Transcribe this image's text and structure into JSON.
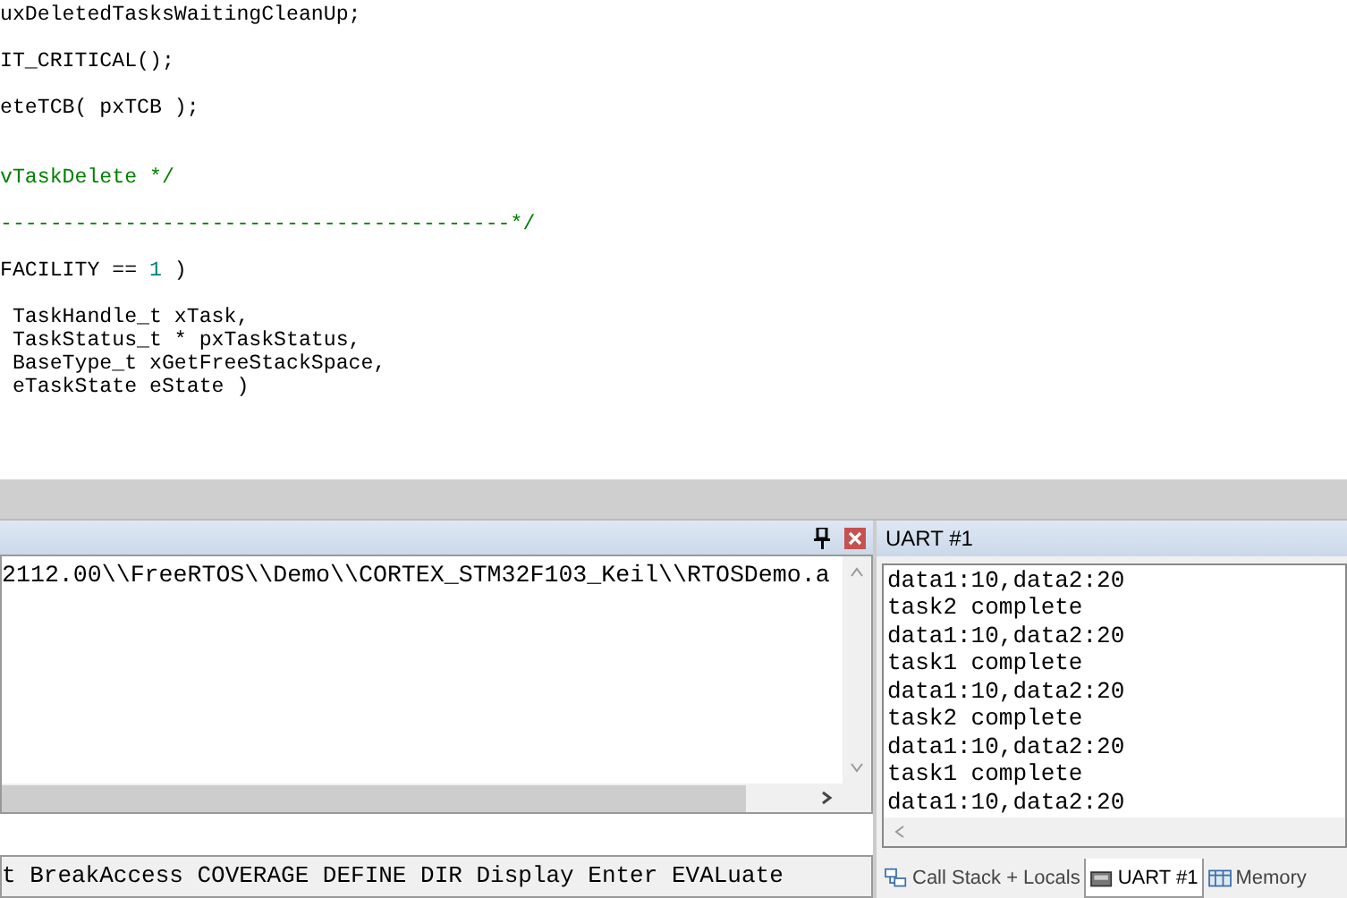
{
  "editor": {
    "lines": [
      {
        "kind": "code",
        "segments": [
          {
            "text": "uxDeletedTasksWaitingCleanUp;",
            "kind": "plain"
          }
        ]
      },
      {
        "kind": "blank"
      },
      {
        "kind": "code",
        "segments": [
          {
            "text": "IT_CRITICAL();",
            "kind": "plain"
          }
        ]
      },
      {
        "kind": "blank"
      },
      {
        "kind": "code",
        "segments": [
          {
            "text": "eteTCB( pxTCB );",
            "kind": "plain"
          }
        ]
      },
      {
        "kind": "blank"
      },
      {
        "kind": "blank"
      },
      {
        "kind": "code",
        "segments": [
          {
            "text": "vTaskDelete */",
            "kind": "comment"
          }
        ]
      },
      {
        "kind": "blank"
      },
      {
        "kind": "code",
        "segments": [
          {
            "text": "-----------------------------------------*/",
            "kind": "comment"
          }
        ]
      },
      {
        "kind": "blank"
      },
      {
        "kind": "code",
        "segments": [
          {
            "text": "FACILITY == ",
            "kind": "plain"
          },
          {
            "text": "1",
            "kind": "number"
          },
          {
            "text": " )",
            "kind": "plain"
          }
        ]
      },
      {
        "kind": "blank"
      },
      {
        "kind": "code",
        "segments": [
          {
            "text": " TaskHandle_t xTask,",
            "kind": "plain"
          }
        ]
      },
      {
        "kind": "code",
        "segments": [
          {
            "text": " TaskStatus_t * pxTaskStatus,",
            "kind": "plain"
          }
        ]
      },
      {
        "kind": "code",
        "segments": [
          {
            "text": " BaseType_t xGetFreeStackSpace,",
            "kind": "plain"
          }
        ]
      },
      {
        "kind": "code",
        "segments": [
          {
            "text": " eTaskState eState )",
            "kind": "plain"
          }
        ]
      }
    ]
  },
  "command_panel": {
    "output": "2112.00\\\\FreeRTOS\\\\Demo\\\\CORTEX_STM32F103_Keil\\\\RTOSDemo.a",
    "command_hints": "t BreakAccess COVERAGE DEFINE DIR Display Enter EVALuate"
  },
  "uart_panel": {
    "title": "UART #1",
    "lines": [
      "data1:10,data2:20",
      "task2 complete",
      "data1:10,data2:20",
      "task1 complete",
      "data1:10,data2:20",
      "task2 complete",
      "data1:10,data2:20",
      "task1 complete",
      "data1:10,data2:20"
    ],
    "tabs": [
      {
        "label": "Call Stack + Locals",
        "selected": false
      },
      {
        "label": "UART #1",
        "selected": true
      },
      {
        "label": "Memory",
        "selected": false
      }
    ]
  }
}
